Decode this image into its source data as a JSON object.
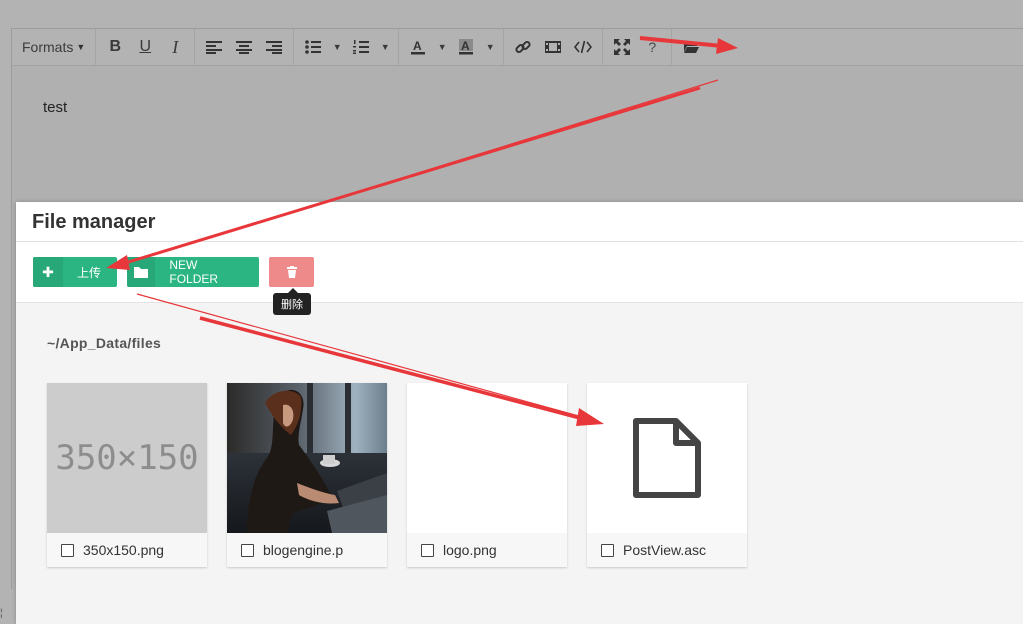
{
  "toolbar": {
    "formats_label": "Formats",
    "buttons": [
      {
        "name": "bold",
        "glyph": "B"
      },
      {
        "name": "underline",
        "glyph": "U"
      },
      {
        "name": "italic",
        "glyph": "I"
      }
    ]
  },
  "editor": {
    "content": "test"
  },
  "modal": {
    "title": "File manager",
    "upload_label": "上传",
    "new_folder_label": "NEW FOLDER",
    "delete_tooltip": "删除",
    "path": "~/App_Data/files",
    "files": [
      {
        "name": "350x150.png",
        "thumb_text": "350×150",
        "type": "placeholder"
      },
      {
        "name": "blogengine.p",
        "type": "photo"
      },
      {
        "name": "logo.png",
        "type": "blank"
      },
      {
        "name": "PostView.asc",
        "type": "document"
      }
    ]
  },
  "colors": {
    "accent_green": "#2bb583",
    "delete_red": "#ee8a8a",
    "arrow_red": "#e8373a"
  }
}
